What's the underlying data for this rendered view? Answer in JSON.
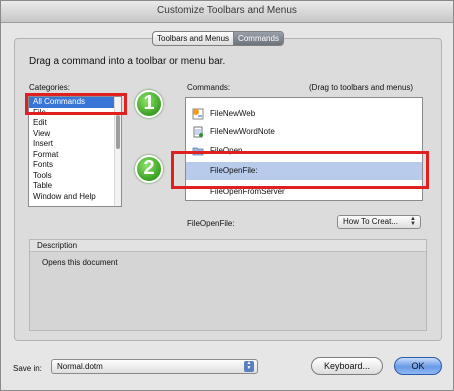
{
  "window": {
    "title": "Customize Toolbars and Menus"
  },
  "tabs": [
    {
      "label": "Toolbars and Menus",
      "active": false
    },
    {
      "label": "Commands",
      "active": true
    }
  ],
  "instruction": "Drag a command into a toolbar or menu bar.",
  "categories": {
    "label": "Categories:",
    "items": [
      "All Commands",
      "File",
      "Edit",
      "View",
      "Insert",
      "Format",
      "Fonts",
      "Tools",
      "Table",
      "Window and Help"
    ],
    "selected_index": 0
  },
  "commands": {
    "label": "Commands:",
    "hint": "(Drag to toolbars and menus)",
    "items": [
      {
        "label": "FileNewWeb",
        "icon": "web-page-icon"
      },
      {
        "label": "FileNewWordNote",
        "icon": "document-note-icon"
      },
      {
        "label": "FileOpen",
        "icon": "folder-open-icon"
      },
      {
        "label": "FileOpenFile:",
        "icon": "",
        "selected": true
      },
      {
        "label": "FileOpenFromServer",
        "icon": ""
      }
    ]
  },
  "selected_command": {
    "name_label": "FileOpenFile:",
    "menu_button": "How To Creat..."
  },
  "description": {
    "header": "Description",
    "text": "Opens this document"
  },
  "footer": {
    "save_label": "Save in:",
    "save_value": "Normal.dotm",
    "keyboard_button": "Keyboard...",
    "ok_button": "OK"
  },
  "annotations": [
    {
      "number": "1"
    },
    {
      "number": "2"
    }
  ],
  "colors": {
    "selection": "#3875d7",
    "command_selection": "#b9cbea",
    "callout_red": "#e02020",
    "badge_green": "#3aa021"
  }
}
